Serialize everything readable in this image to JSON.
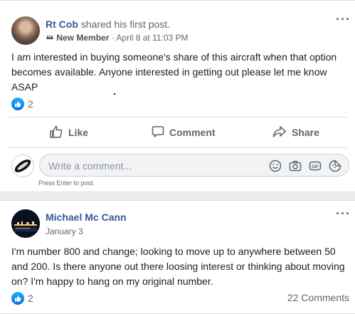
{
  "post1": {
    "author": "Rt Cob",
    "action": "shared his first post.",
    "badge": "New Member",
    "date": "April 8 at 11:03 PM",
    "text": "I am interested in buying someone's share of this aircraft when that option becomes available. Anyone interested in getting out please let me know ASAP",
    "reaction_count": "2",
    "actions": {
      "like": "Like",
      "comment": "Comment",
      "share": "Share"
    },
    "comment_placeholder": "Write a comment...",
    "hint": "Press Enter to post.",
    "more": "···"
  },
  "post2": {
    "author": "Michael Mc Cann",
    "date": "January 3",
    "text": "I'm number 800 and change; looking to move up to anywhere between 50 and 200. Is there anyone out there loosing interest or thinking about moving on? I'm happy to hang on my original number.",
    "reaction_count": "2",
    "comments_count": "22 Comments",
    "more": "···"
  },
  "colors": {
    "link": "#385898",
    "like": "#1877f2",
    "muted": "#606770"
  },
  "icons": [
    "like-reaction-icon",
    "thumbs-up-icon",
    "comment-icon",
    "share-icon",
    "emoji-icon",
    "camera-icon",
    "gif-icon",
    "sticker-icon",
    "new-member-badge-icon"
  ]
}
